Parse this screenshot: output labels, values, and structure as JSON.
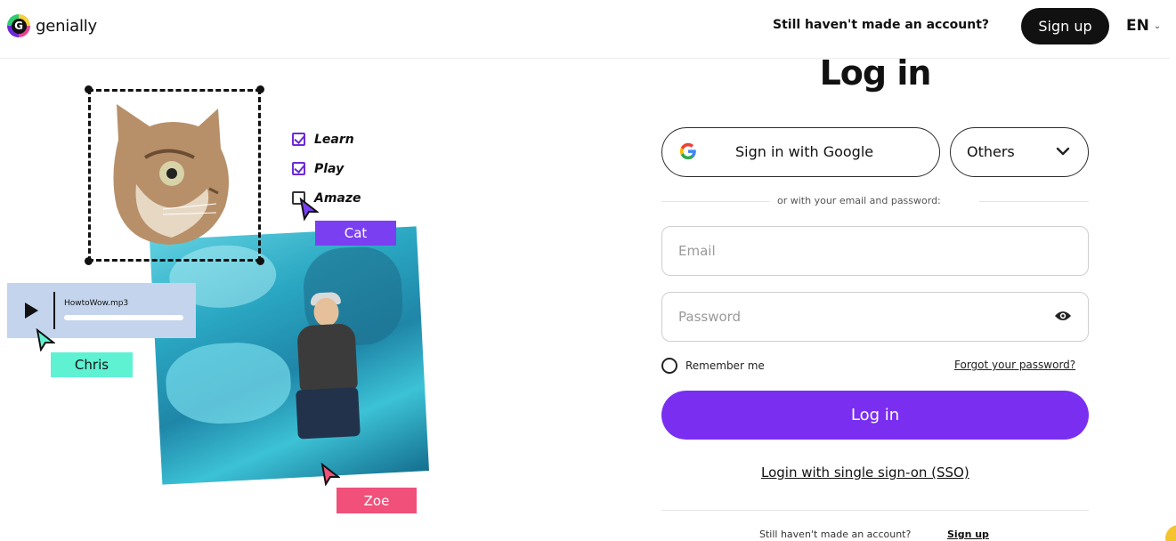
{
  "header": {
    "logo_glyph": "G",
    "logo_text": "genially",
    "account_question": "Still haven't made an account?",
    "signup_label": "Sign up",
    "language": "EN",
    "language_chevron": "⌄"
  },
  "illustration": {
    "checklist": [
      {
        "label": "Learn",
        "checked": true
      },
      {
        "label": "Play",
        "checked": true
      },
      {
        "label": "Amaze",
        "checked": false
      }
    ],
    "tags": {
      "cat": "Cat",
      "chris": "Chris",
      "zoe": "Zoe"
    },
    "audio_filename": "HowtoWow.mp3",
    "colors": {
      "cat_tag": "#7a3ff0",
      "chris_tag": "#5ff2d2",
      "zoe_tag": "#f0507a",
      "audio_card": "#c4d4ec"
    }
  },
  "login": {
    "title": "Log in",
    "google_button": "Sign in with Google",
    "others_label": "Others",
    "divider_text": "or with your email and password:",
    "email_placeholder": "Email",
    "password_placeholder": "Password",
    "remember_label": "Remember me",
    "forgot_label": "Forgot your password?",
    "login_button": "Log in",
    "sso_link": "Login with single sign-on (SSO)",
    "bottom_question": "Still haven't made an account?",
    "bottom_signup": "Sign up",
    "accent_color": "#7a2ff0"
  },
  "icons": [
    "google-icon",
    "chevron-down-icon",
    "eye-icon",
    "play-icon",
    "cursor-icon"
  ]
}
